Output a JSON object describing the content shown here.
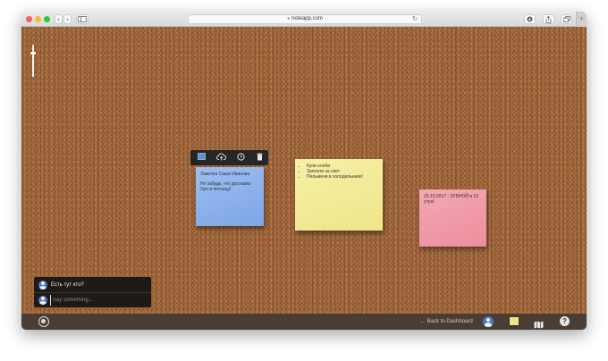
{
  "browser": {
    "url": "noteapp.com",
    "new_tab_label": "+",
    "back_label": "‹",
    "forward_label": "›"
  },
  "board": {
    "zoom_level": 0.25
  },
  "notes": {
    "blue": {
      "title": "Заметка Саши Иванова",
      "body": "Не забудь, что доставка 2ую в пятницу!"
    },
    "yellow": {
      "items": [
        "Купи хлеба",
        "Заплати за свет",
        "Пельмени в холодильнике!"
      ]
    },
    "pink": {
      "body": "23.10.2017 - ЗУБНОЙ в 10 утра!"
    }
  },
  "chat": {
    "message": "Есть тут кто?",
    "input_placeholder": "Say something..."
  },
  "bottombar": {
    "back_label": "← Back to Dashboard",
    "help_label": "?"
  },
  "colors": {
    "cork": "#a56b3f",
    "note_blue": "#8fb3ee",
    "note_yellow": "#f3eb9a",
    "note_pink": "#f09aa9",
    "chat_bg": "#141414"
  }
}
